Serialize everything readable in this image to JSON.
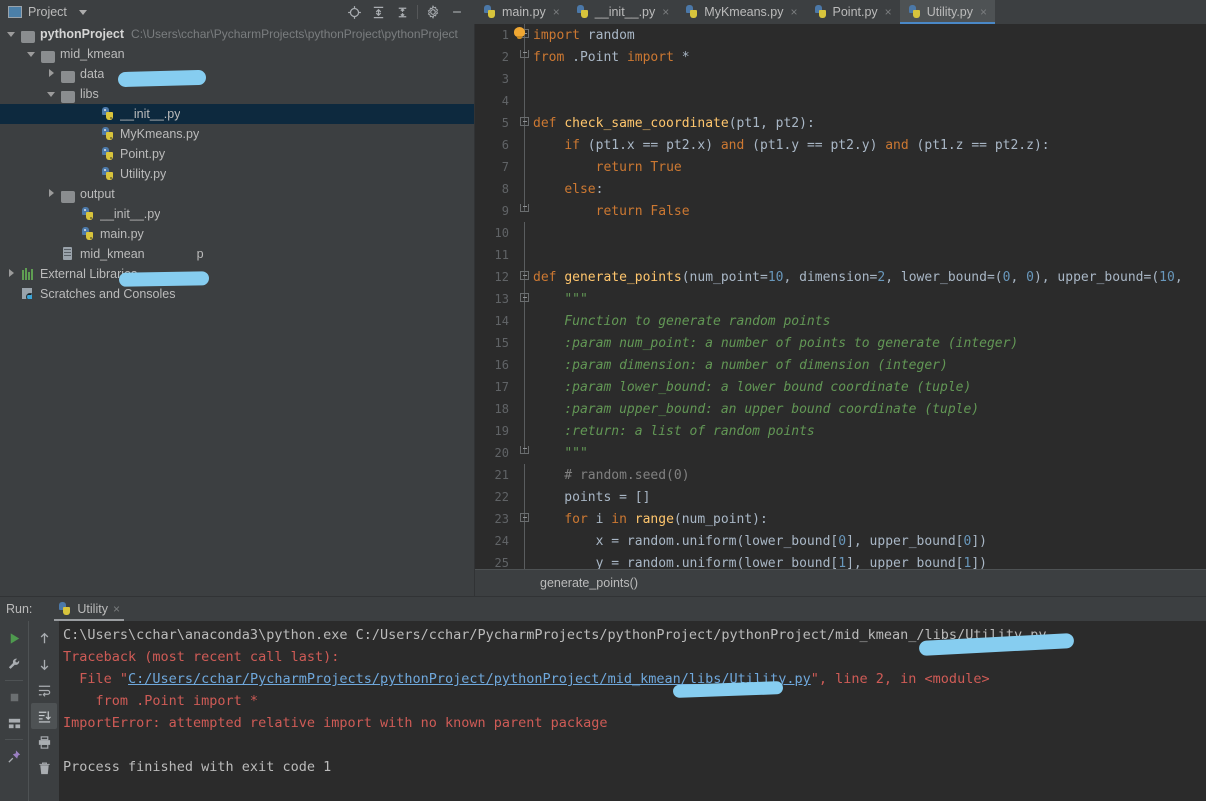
{
  "project_panel": {
    "title": "Project",
    "icons": [
      "project-icon",
      "caret-down-icon",
      "locate-icon",
      "expand-all-icon",
      "collapse-all-icon",
      "gear-icon",
      "minimize-icon"
    ],
    "tree": [
      {
        "indent": 0,
        "arrow": "down",
        "icon": "folder-icon",
        "label": "pythonProject",
        "bold": true,
        "hint": "C:\\Users\\cchar\\PycharmProjects\\pythonProject\\pythonProject"
      },
      {
        "indent": 1,
        "arrow": "down",
        "icon": "folder-icon",
        "label": "mid_kmean",
        "bold": false,
        "hint": "",
        "redacted": true
      },
      {
        "indent": 2,
        "arrow": "right",
        "icon": "folder-icon",
        "label": "data",
        "bold": false,
        "hint": ""
      },
      {
        "indent": 2,
        "arrow": "down",
        "icon": "folder-icon",
        "label": "libs",
        "bold": false,
        "hint": ""
      },
      {
        "indent": 4,
        "arrow": "none",
        "icon": "python-file-icon",
        "label": "__init__.py",
        "bold": false,
        "hint": "",
        "selected": true
      },
      {
        "indent": 4,
        "arrow": "none",
        "icon": "python-file-icon",
        "label": "MyKmeans.py",
        "bold": false,
        "hint": ""
      },
      {
        "indent": 4,
        "arrow": "none",
        "icon": "python-file-icon",
        "label": "Point.py",
        "bold": false,
        "hint": ""
      },
      {
        "indent": 4,
        "arrow": "none",
        "icon": "python-file-icon",
        "label": "Utility.py",
        "bold": false,
        "hint": ""
      },
      {
        "indent": 2,
        "arrow": "right",
        "icon": "folder-icon",
        "label": "output",
        "bold": false,
        "hint": ""
      },
      {
        "indent": 3,
        "arrow": "none",
        "icon": "python-file-icon",
        "label": "__init__.py",
        "bold": false,
        "hint": ""
      },
      {
        "indent": 3,
        "arrow": "none",
        "icon": "python-file-icon",
        "label": "main.py",
        "bold": false,
        "hint": ""
      },
      {
        "indent": 2,
        "arrow": "none",
        "icon": "iml-file-icon",
        "label": "mid_kmean",
        "bold": false,
        "hint": "",
        "suffix": "p",
        "redacted": true
      },
      {
        "indent": 0,
        "arrow": "right",
        "icon": "external-libraries-icon",
        "label": "External Libraries",
        "bold": false,
        "hint": ""
      },
      {
        "indent": 0,
        "arrow": "none",
        "icon": "scratches-icon",
        "label": "Scratches and Consoles",
        "bold": false,
        "hint": ""
      }
    ]
  },
  "editor": {
    "tabs": [
      {
        "label": "main.py",
        "icon": "python-file-icon",
        "active": false,
        "close": "×"
      },
      {
        "label": "__init__.py",
        "icon": "python-file-icon",
        "active": false,
        "close": "×"
      },
      {
        "label": "MyKmeans.py",
        "icon": "python-file-icon",
        "active": false,
        "close": "×"
      },
      {
        "label": "Point.py",
        "icon": "python-file-icon",
        "active": false,
        "close": "×"
      },
      {
        "label": "Utility.py",
        "icon": "python-file-icon",
        "active": true,
        "close": "×"
      }
    ],
    "breadcrumb": "generate_points()",
    "lines": [
      {
        "n": "1",
        "fold": "start",
        "tokens": [
          {
            "t": "import ",
            "c": "kw"
          },
          {
            "t": "random",
            "c": "pln"
          }
        ]
      },
      {
        "n": "2",
        "fold": "end",
        "tokens": [
          {
            "t": "from ",
            "c": "kw"
          },
          {
            "t": ".Point ",
            "c": "pln"
          },
          {
            "t": "import ",
            "c": "kw"
          },
          {
            "t": "*",
            "c": "pln"
          }
        ]
      },
      {
        "n": "3",
        "fold": "none",
        "tokens": []
      },
      {
        "n": "4",
        "fold": "none",
        "tokens": []
      },
      {
        "n": "5",
        "fold": "start",
        "tokens": [
          {
            "t": "def ",
            "c": "kw"
          },
          {
            "t": "check_same_coordinate",
            "c": "fn"
          },
          {
            "t": "(pt1, pt2):",
            "c": "pln"
          }
        ]
      },
      {
        "n": "6",
        "fold": "none",
        "tokens": [
          {
            "t": "    ",
            "c": "pln"
          },
          {
            "t": "if ",
            "c": "kw"
          },
          {
            "t": "(pt1.x == pt2.x) ",
            "c": "pln"
          },
          {
            "t": "and ",
            "c": "kw"
          },
          {
            "t": "(pt1.y == pt2.y) ",
            "c": "pln"
          },
          {
            "t": "and ",
            "c": "kw"
          },
          {
            "t": "(pt1.z == pt2.z):",
            "c": "pln"
          }
        ]
      },
      {
        "n": "7",
        "fold": "none",
        "tokens": [
          {
            "t": "        ",
            "c": "pln"
          },
          {
            "t": "return True",
            "c": "kw"
          }
        ]
      },
      {
        "n": "8",
        "fold": "none",
        "tokens": [
          {
            "t": "    ",
            "c": "pln"
          },
          {
            "t": "else",
            "c": "kw"
          },
          {
            "t": ":",
            "c": "pln"
          }
        ]
      },
      {
        "n": "9",
        "fold": "endcap",
        "tokens": [
          {
            "t": "        ",
            "c": "pln"
          },
          {
            "t": "return False",
            "c": "kw"
          }
        ]
      },
      {
        "n": "10",
        "fold": "none",
        "tokens": []
      },
      {
        "n": "11",
        "fold": "none",
        "tokens": []
      },
      {
        "n": "12",
        "fold": "start",
        "tokens": [
          {
            "t": "def ",
            "c": "kw"
          },
          {
            "t": "generate_points",
            "c": "fn"
          },
          {
            "t": "(num_point=",
            "c": "pln"
          },
          {
            "t": "10",
            "c": "num"
          },
          {
            "t": ", dimension=",
            "c": "pln"
          },
          {
            "t": "2",
            "c": "num"
          },
          {
            "t": ", lower_bound=(",
            "c": "pln"
          },
          {
            "t": "0",
            "c": "num"
          },
          {
            "t": ", ",
            "c": "pln"
          },
          {
            "t": "0",
            "c": "num"
          },
          {
            "t": "), upper_bound=(",
            "c": "pln"
          },
          {
            "t": "10",
            "c": "num"
          },
          {
            "t": ",",
            "c": "pln"
          }
        ]
      },
      {
        "n": "13",
        "fold": "startbulb",
        "tokens": [
          {
            "t": "    ",
            "c": "pln"
          },
          {
            "t": "\"\"\"",
            "c": "doc"
          }
        ]
      },
      {
        "n": "14",
        "fold": "none",
        "tokens": [
          {
            "t": "    Function to generate random points",
            "c": "doc"
          }
        ]
      },
      {
        "n": "15",
        "fold": "none",
        "tokens": [
          {
            "t": "    :param num_point: a number of points to generate (integer)",
            "c": "doc"
          }
        ]
      },
      {
        "n": "16",
        "fold": "none",
        "tokens": [
          {
            "t": "    :param dimension: a number of dimension (integer)",
            "c": "doc"
          }
        ]
      },
      {
        "n": "17",
        "fold": "none",
        "tokens": [
          {
            "t": "    :param lower_bound: a lower bound coordinate (tuple)",
            "c": "doc"
          }
        ]
      },
      {
        "n": "18",
        "fold": "none",
        "tokens": [
          {
            "t": "    :param upper_bound: an upper bound coordinate (tuple)",
            "c": "doc"
          }
        ]
      },
      {
        "n": "19",
        "fold": "none",
        "tokens": [
          {
            "t": "    :return: a list of random points",
            "c": "doc"
          }
        ]
      },
      {
        "n": "20",
        "fold": "endcap",
        "tokens": [
          {
            "t": "    ",
            "c": "pln"
          },
          {
            "t": "\"\"\"",
            "c": "doc"
          }
        ]
      },
      {
        "n": "21",
        "fold": "none",
        "tokens": [
          {
            "t": "    # random.seed(0)",
            "c": "cmt"
          }
        ]
      },
      {
        "n": "22",
        "fold": "none",
        "tokens": [
          {
            "t": "    points = []",
            "c": "pln"
          }
        ]
      },
      {
        "n": "23",
        "fold": "start",
        "tokens": [
          {
            "t": "    ",
            "c": "pln"
          },
          {
            "t": "for ",
            "c": "kw"
          },
          {
            "t": "i ",
            "c": "pln"
          },
          {
            "t": "in ",
            "c": "kw"
          },
          {
            "t": "range",
            "c": "fn"
          },
          {
            "t": "(num_point):",
            "c": "pln"
          }
        ]
      },
      {
        "n": "24",
        "fold": "none",
        "tokens": [
          {
            "t": "        x = random.uniform(lower_bound[",
            "c": "pln"
          },
          {
            "t": "0",
            "c": "num"
          },
          {
            "t": "], upper_bound[",
            "c": "pln"
          },
          {
            "t": "0",
            "c": "num"
          },
          {
            "t": "])",
            "c": "pln"
          }
        ]
      },
      {
        "n": "25",
        "fold": "none",
        "tokens": [
          {
            "t": "        y = random.uniform(lower_bound[",
            "c": "pln"
          },
          {
            "t": "1",
            "c": "num"
          },
          {
            "t": "], upper_bound[",
            "c": "pln"
          },
          {
            "t": "1",
            "c": "num"
          },
          {
            "t": "])",
            "c": "pln"
          }
        ]
      }
    ]
  },
  "run_panel": {
    "label": "Run:",
    "tab_label": "Utility",
    "tab_close": "×",
    "side_icons_left": [
      "run-icon",
      "wrench-icon",
      "stop-icon",
      "layout-icon",
      "pin-icon"
    ],
    "side_icons_right": [
      "arrow-up-icon",
      "arrow-down-icon",
      "soft-wrap-icon",
      "scroll-to-end-icon",
      "print-icon",
      "trash-icon"
    ],
    "console": [
      {
        "segments": [
          {
            "t": "C:\\Users\\cchar\\anaconda3\\python.exe C:/Users/cchar/PycharmProjects/pythonProject/pythonProject/mid_kmean_",
            "c": "plain"
          },
          {
            "t": "/libs/Utility.py",
            "c": "plain"
          }
        ]
      },
      {
        "segments": [
          {
            "t": "Traceback (most recent call last):",
            "c": "err"
          }
        ]
      },
      {
        "segments": [
          {
            "t": "  File \"",
            "c": "err"
          },
          {
            "t": "C:/Users/cchar/PycharmProjects/pythonProject/pythonProject/mid_kmean",
            "c": "link"
          },
          {
            "t": "/libs/Utility.py",
            "c": "link"
          },
          {
            "t": "\", line 2, in <module>",
            "c": "err"
          }
        ]
      },
      {
        "segments": [
          {
            "t": "    from .Point import *",
            "c": "err"
          }
        ]
      },
      {
        "segments": [
          {
            "t": "ImportError: attempted relative import with no known parent package",
            "c": "err"
          }
        ]
      },
      {
        "segments": []
      },
      {
        "segments": [
          {
            "t": "Process finished with exit code 1",
            "c": "plain"
          }
        ]
      }
    ]
  },
  "colors": {
    "chrome": "#3c3f41",
    "editor_bg": "#2b2b2b",
    "selection": "#0d293e",
    "tab_active": "#4e5254",
    "accent_underline": "#4a88c7",
    "error_text": "#cf5b56",
    "link_text": "#6fa8dc",
    "redaction": "#86cdf0",
    "keyword": "#cc7832",
    "function": "#ffc66d",
    "number": "#6897bb",
    "docstring": "#629755",
    "comment": "#808080",
    "plain": "#a9b7c6"
  }
}
